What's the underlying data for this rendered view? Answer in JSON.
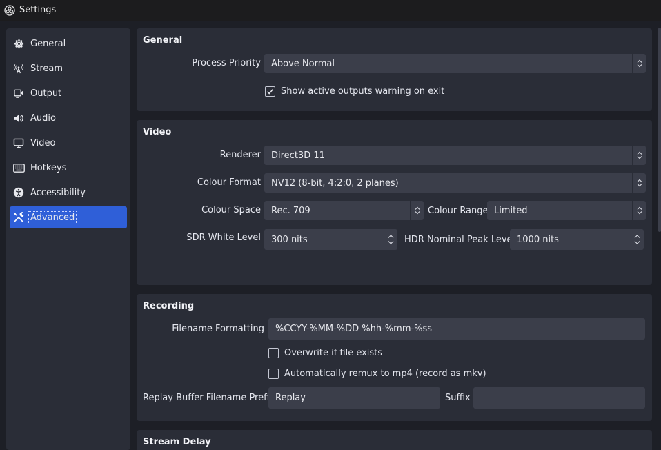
{
  "window": {
    "title": "Settings"
  },
  "sidebar": {
    "items": [
      {
        "label": "General",
        "icon": "gear-icon"
      },
      {
        "label": "Stream",
        "icon": "antenna-icon"
      },
      {
        "label": "Output",
        "icon": "output-camera-icon"
      },
      {
        "label": "Audio",
        "icon": "speaker-icon"
      },
      {
        "label": "Video",
        "icon": "monitor-icon"
      },
      {
        "label": "Hotkeys",
        "icon": "keyboard-icon"
      },
      {
        "label": "Accessibility",
        "icon": "accessibility-icon"
      },
      {
        "label": "Advanced",
        "icon": "tools-icon",
        "active": true
      }
    ]
  },
  "general": {
    "title": "General",
    "process_priority_label": "Process Priority",
    "process_priority_value": "Above Normal",
    "show_warning_label": "Show active outputs warning on exit",
    "show_warning_checked": true
  },
  "video": {
    "title": "Video",
    "renderer_label": "Renderer",
    "renderer_value": "Direct3D 11",
    "colour_format_label": "Colour Format",
    "colour_format_value": "NV12 (8-bit, 4:2:0, 2 planes)",
    "colour_space_label": "Colour Space",
    "colour_space_value": "Rec. 709",
    "colour_range_label": "Colour Range",
    "colour_range_value": "Limited",
    "sdr_label": "SDR White Level",
    "sdr_value": "300 nits",
    "hdr_label": "HDR Nominal Peak Level",
    "hdr_value": "1000 nits"
  },
  "recording": {
    "title": "Recording",
    "filename_label": "Filename Formatting",
    "filename_value": "%CCYY-%MM-%DD %hh-%mm-%ss",
    "overwrite_label": "Overwrite if file exists",
    "overwrite_checked": false,
    "remux_label": "Automatically remux to mp4 (record as mkv)",
    "remux_checked": false,
    "replay_prefix_label": "Replay Buffer Filename Prefix",
    "replay_prefix_value": "Replay",
    "suffix_label": "Suffix",
    "suffix_value": ""
  },
  "stream_delay": {
    "title": "Stream Delay"
  },
  "colors": {
    "accent": "#2f5fd8",
    "panel": "#2a2d37",
    "input": "#3b3e4a",
    "background": "#1d1f26"
  }
}
